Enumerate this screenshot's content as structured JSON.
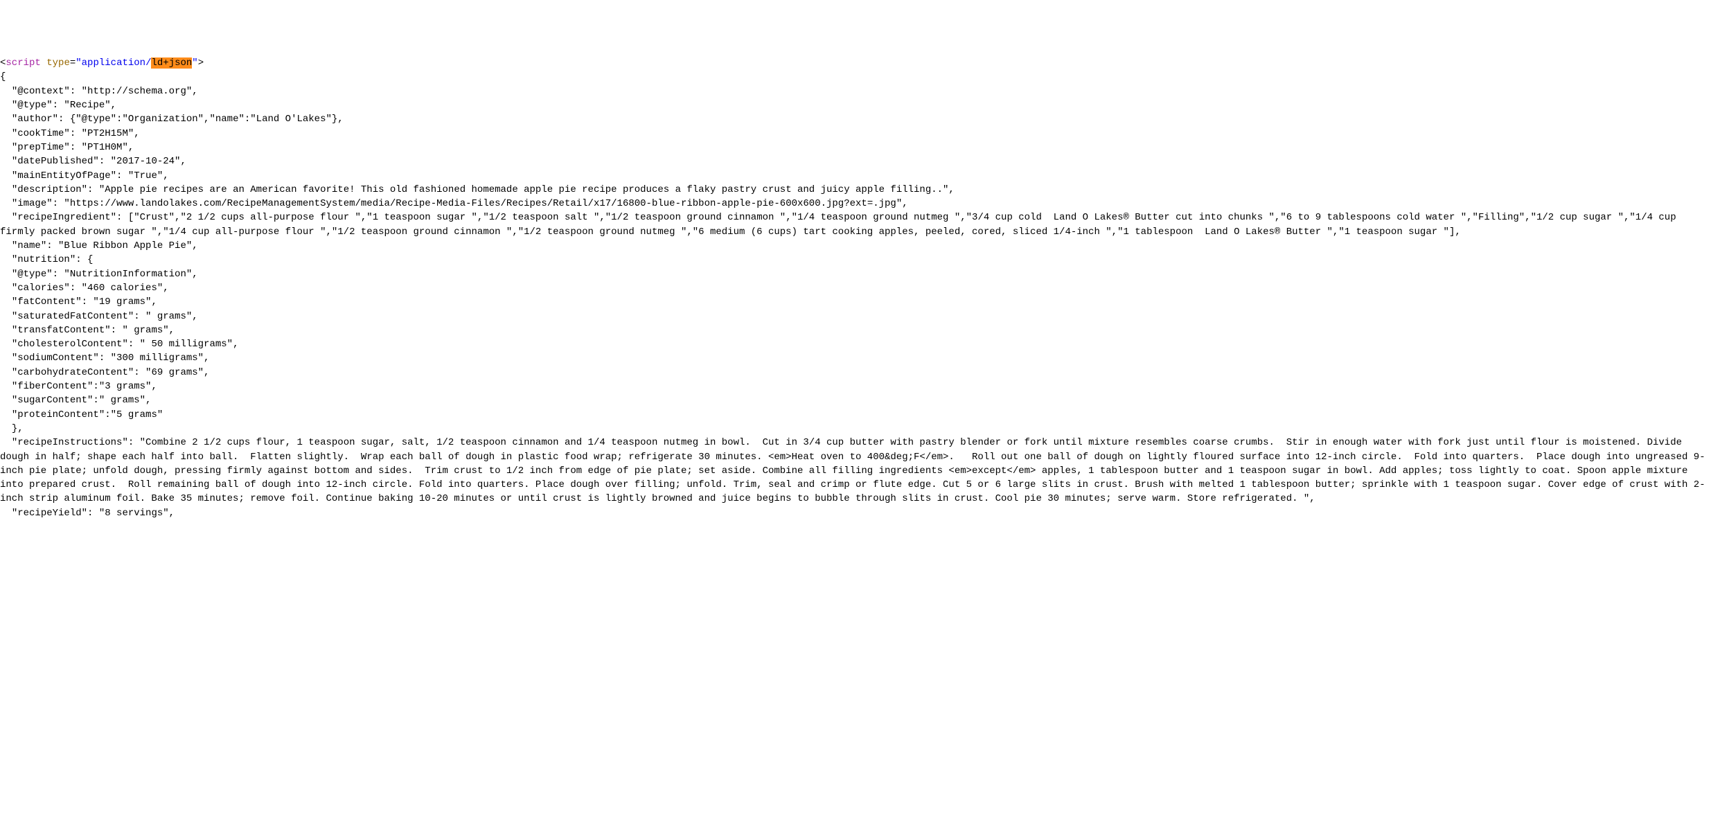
{
  "tag": {
    "open_bracket": "<",
    "name": "script",
    "attr_type_name": "type",
    "equals": "=",
    "quote": "\"",
    "attr_value_prefix": "application/",
    "attr_value_highlight": "ld+json",
    "close_bracket": ">"
  },
  "lines": [
    "{",
    "  \"@context\": \"http://schema.org\",",
    "  \"@type\": \"Recipe\",",
    "  \"author\": {\"@type\":\"Organization\",\"name\":\"Land O'Lakes\"},",
    "  \"cookTime\": \"PT2H15M\",",
    "  \"prepTime\": \"PT1H0M\",",
    "  \"datePublished\": \"2017-10-24\",",
    "  \"mainEntityOfPage\": \"True\",",
    "  \"description\": \"Apple pie recipes are an American favorite! This old fashioned homemade apple pie recipe produces a flaky pastry crust and juicy apple filling..\",",
    "  \"image\": \"https://www.landolakes.com/RecipeManagementSystem/media/Recipe-Media-Files/Recipes/Retail/x17/16800-blue-ribbon-apple-pie-600x600.jpg?ext=.jpg\",",
    "  \"recipeIngredient\": [\"Crust\",\"2 1/2 cups all-purpose flour \",\"1 teaspoon sugar \",\"1/2 teaspoon salt \",\"1/2 teaspoon ground cinnamon \",\"1/4 teaspoon ground nutmeg \",\"3/4 cup cold  Land O Lakes® Butter cut into chunks \",\"6 to 9 tablespoons cold water \",\"Filling\",\"1/2 cup sugar \",\"1/4 cup firmly packed brown sugar \",\"1/4 cup all-purpose flour \",\"1/2 teaspoon ground cinnamon \",\"1/2 teaspoon ground nutmeg \",\"6 medium (6 cups) tart cooking apples, peeled, cored, sliced 1/4-inch \",\"1 tablespoon  Land O Lakes® Butter \",\"1 teaspoon sugar \"],",
    "  \"name\": \"Blue Ribbon Apple Pie\",",
    "  \"nutrition\": {",
    "  \"@type\": \"NutritionInformation\",",
    "  \"calories\": \"460 calories\",",
    "  \"fatContent\": \"19 grams\",",
    "  \"saturatedFatContent\": \" grams\",",
    "  \"transfatContent\": \" grams\",",
    "  \"cholesterolContent\": \" 50 milligrams\",",
    "  \"sodiumContent\": \"300 milligrams\",",
    "  \"carbohydrateContent\": \"69 grams\",",
    "  \"fiberContent\":\"3 grams\",",
    "  \"sugarContent\":\" grams\",",
    "  \"proteinContent\":\"5 grams\"",
    "  },",
    "  \"recipeInstructions\": \"Combine 2 1/2 cups flour, 1 teaspoon sugar, salt, 1/2 teaspoon cinnamon and 1/4 teaspoon nutmeg in bowl.  Cut in 3/4 cup butter with pastry blender or fork until mixture resembles coarse crumbs.  Stir in enough water with fork just until flour is moistened. Divide dough in half; shape each half into ball.  Flatten slightly.  Wrap each ball of dough in plastic food wrap; refrigerate 30 minutes. <em>Heat oven to 400&deg;F</em>.   Roll out one ball of dough on lightly floured surface into 12-inch circle.  Fold into quarters.  Place dough into ungreased 9-inch pie plate; unfold dough, pressing firmly against bottom and sides.  Trim crust to 1/2 inch from edge of pie plate; set aside. Combine all filling ingredients <em>except</em> apples, 1 tablespoon butter and 1 teaspoon sugar in bowl. Add apples; toss lightly to coat. Spoon apple mixture into prepared crust.  Roll remaining ball of dough into 12-inch circle. Fold into quarters. Place dough over filling; unfold. Trim, seal and crimp or flute edge. Cut 5 or 6 large slits in crust. Brush with melted 1 tablespoon butter; sprinkle with 1 teaspoon sugar. Cover edge of crust with 2-inch strip aluminum foil. Bake 35 minutes; remove foil. Continue baking 10-20 minutes or until crust is lightly browned and juice begins to bubble through slits in crust. Cool pie 30 minutes; serve warm. Store refrigerated. \",",
    "  \"recipeYield\": \"8 servings\","
  ]
}
